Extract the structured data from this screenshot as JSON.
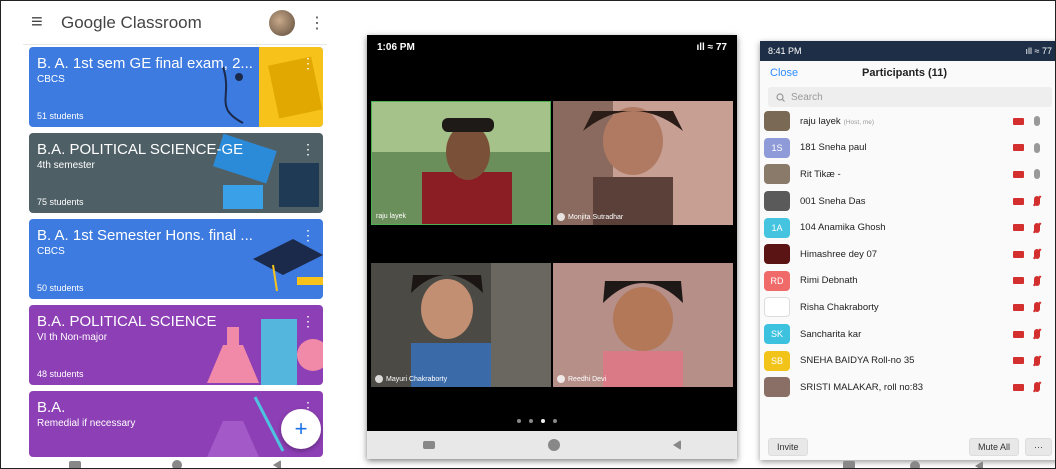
{
  "classroom": {
    "app_title": "Google Classroom",
    "menu_icon": "≡",
    "more_icon": "⋮",
    "fab_icon": "+",
    "cards": [
      {
        "title": "B. A. 1st sem GE final exam, 2...",
        "section": "CBCS",
        "students": "51 students",
        "color": "#3d7be0"
      },
      {
        "title": "B.A. POLITICAL SCIENCE-GE",
        "section": "4th semester",
        "students": "75 students",
        "color": "#4e5f66"
      },
      {
        "title": "B. A. 1st Semester Hons. final ...",
        "section": "CBCS",
        "students": "50 students",
        "color": "#3d7be0"
      },
      {
        "title": "B.A. POLITICAL SCIENCE",
        "section": "VI th Non-major",
        "students": "48 students",
        "color": "#8d3fb5"
      },
      {
        "title": "B.A.",
        "section": "Remedial if necessary",
        "students": "",
        "color": "#8d3fb5"
      }
    ]
  },
  "call": {
    "status_time": "1:06 PM",
    "status_right": "ıll ≈ 77",
    "tiles": [
      {
        "name": "raju layek"
      },
      {
        "name": "Monjita Sutradhar"
      },
      {
        "name": "Mayuri Chakraborty"
      },
      {
        "name": "Reedhi Devi"
      }
    ]
  },
  "participants": {
    "status_time": "8:41 PM",
    "status_right": "ıll ≈ 77",
    "close_label": "Close",
    "title": "Participants (11)",
    "search_placeholder": "Search",
    "rows": [
      {
        "initials": "",
        "color": "#7a6a55",
        "name": "raju layek",
        "role": "(Host, me)",
        "mic_muted": false
      },
      {
        "initials": "1S",
        "color": "#8e9bd8",
        "name": "181 Sneha paul",
        "role": "",
        "mic_muted": false
      },
      {
        "initials": "",
        "color": "#8a7a6a",
        "name": "Rit Tikæ -",
        "role": "",
        "mic_muted": false
      },
      {
        "initials": "",
        "color": "#5a5a5a",
        "name": "001 Sneha Das",
        "role": "",
        "mic_muted": true
      },
      {
        "initials": "1A",
        "color": "#45c4e0",
        "name": "104 Anamika Ghosh",
        "role": "",
        "mic_muted": true
      },
      {
        "initials": "",
        "color": "#5a1414",
        "name": "Himashree dey 07",
        "role": "",
        "mic_muted": true
      },
      {
        "initials": "RD",
        "color": "#f06a6a",
        "name": "Rimi Debnath",
        "role": "",
        "mic_muted": true
      },
      {
        "initials": "",
        "color": "#ffffff",
        "name": "Risha Chakraborty",
        "role": "",
        "mic_muted": true
      },
      {
        "initials": "SK",
        "color": "#3cc2df",
        "name": "Sancharita kar",
        "role": "",
        "mic_muted": true
      },
      {
        "initials": "SB",
        "color": "#f2c318",
        "name": "SNEHA BAIDYA Roll-no 35",
        "role": "",
        "mic_muted": true
      },
      {
        "initials": "",
        "color": "#8a6f66",
        "name": "SRISTI MALAKAR, roll no:83",
        "role": "",
        "mic_muted": true
      }
    ],
    "invite_label": "Invite",
    "mute_all_label": "Mute All",
    "more_label": "···"
  }
}
